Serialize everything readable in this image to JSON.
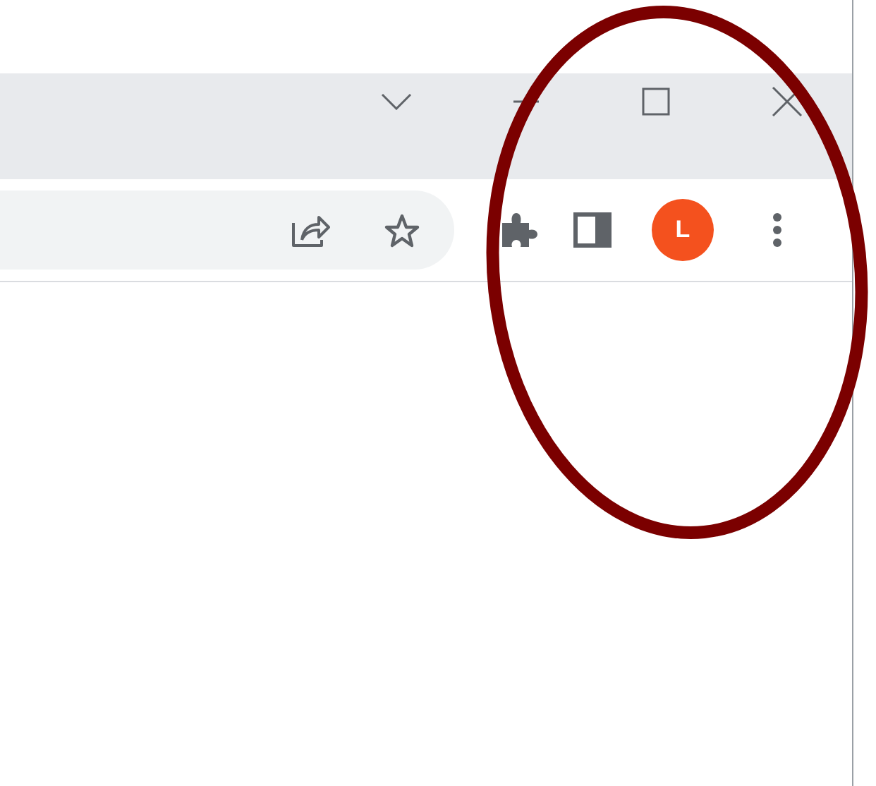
{
  "toolbar": {
    "profile_avatar": {
      "initial": "L"
    }
  }
}
